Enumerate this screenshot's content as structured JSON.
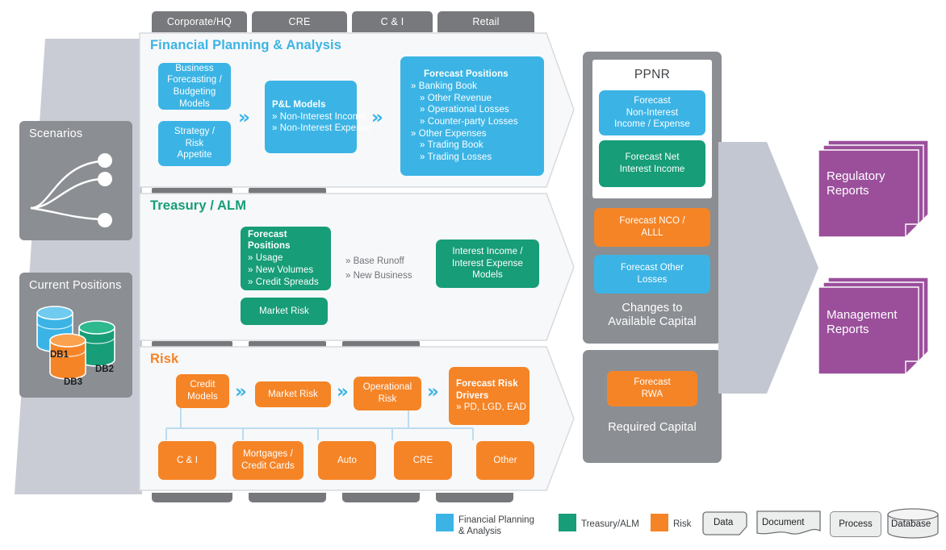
{
  "tabs": [
    {
      "label": "Corporate/HQ"
    },
    {
      "label": "CRE"
    },
    {
      "label": "C & I"
    },
    {
      "label": "Retail"
    }
  ],
  "left_panel": {
    "scenarios": {
      "title": "Scenarios",
      "icon": "scenario-curves-icon"
    },
    "current_positions": {
      "title": "Current Positions",
      "databases": [
        {
          "label": "DB1",
          "color": "#3bb4e5"
        },
        {
          "label": "DB2",
          "color": "#179d78"
        },
        {
          "label": "DB3",
          "color": "#f58426"
        }
      ]
    }
  },
  "sections": {
    "fpa": {
      "title": "Financial Planning & Analysis",
      "color": "#3bb4e5",
      "nodes": {
        "business_forecasting": "Business\nForecasting /\nBudgeting\nModels",
        "strategy_risk": "Strategy /\nRisk\nAppetite",
        "pl_models": {
          "title": "P&L Models",
          "items": [
            "» Non-Interest Income",
            "» Non-Interest Expense"
          ]
        },
        "forecast_positions": {
          "title": "Forecast Positions",
          "items": [
            {
              "text": "» Banking Book",
              "level": 1
            },
            {
              "text": "» Other Revenue",
              "level": 2
            },
            {
              "text": "» Operational Losses",
              "level": 2
            },
            {
              "text": "» Counter-party Losses",
              "level": 2
            },
            {
              "text": "» Other Expenses",
              "level": 1
            },
            {
              "text": "» Trading Book",
              "level": 2
            },
            {
              "text": "» Trading Losses",
              "level": 2
            }
          ]
        }
      }
    },
    "treasury": {
      "title": "Treasury / ALM",
      "color": "#179d78",
      "nodes": {
        "forecast_positions": {
          "title": "Forecast Positions",
          "items": [
            "» Usage",
            "» New Volumes",
            "» Credit Spreads"
          ]
        },
        "market_risk": "Market Risk",
        "mid_list": [
          "» Base Runoff",
          "» New Business"
        ],
        "interest_models": "Interest Income /\nInterest Expense\nModels"
      }
    },
    "risk": {
      "title": "Risk",
      "color": "#f58426",
      "nodes": {
        "credit_models": "Credit\nModels",
        "market_risk": "Market Risk",
        "operational_risk": "Operational\nRisk",
        "forecast_risk_drivers": {
          "title": "Forecast Risk Drivers",
          "items": [
            "» PD, LGD, EAD"
          ]
        },
        "portfolios": [
          "C & I",
          "Mortgages /\nCredit Cards",
          "Auto",
          "CRE",
          "Other"
        ]
      }
    }
  },
  "middle": {
    "ppnr": {
      "label": "PPNR",
      "items": [
        {
          "label": "Forecast\nNon-Interest\nIncome / Expense",
          "color": "#3bb4e5"
        },
        {
          "label": "Forecast Net\nInterest Income",
          "color": "#179d78"
        }
      ]
    },
    "available_capital": {
      "caption": "Changes to\nAvailable Capital",
      "items": [
        {
          "label": "Forecast NCO /\nALLL",
          "color": "#f58426"
        },
        {
          "label": "Forecast Other\nLosses",
          "color": "#3bb4e5"
        }
      ]
    },
    "required_capital": {
      "caption": "Required Capital",
      "items": [
        {
          "label": "Forecast\nRWA",
          "color": "#f58426"
        }
      ]
    }
  },
  "reports": [
    {
      "label": "Regulatory\nReports",
      "color": "#9b4f9b"
    },
    {
      "label": "Management\nReports",
      "color": "#9b4f9b"
    }
  ],
  "legend": {
    "colors": [
      {
        "label": "Financial Planning\n& Analysis",
        "color": "#3bb4e5"
      },
      {
        "label": "Treasury/ALM",
        "color": "#179d78"
      },
      {
        "label": "Risk",
        "color": "#f58426"
      }
    ],
    "shapes": [
      {
        "label": "Data",
        "shape": "data-shape-icon"
      },
      {
        "label": "Document",
        "shape": "document-shape-icon"
      },
      {
        "label": "Process",
        "shape": "process-shape-icon"
      },
      {
        "label": "Database",
        "shape": "database-shape-icon"
      }
    ]
  }
}
